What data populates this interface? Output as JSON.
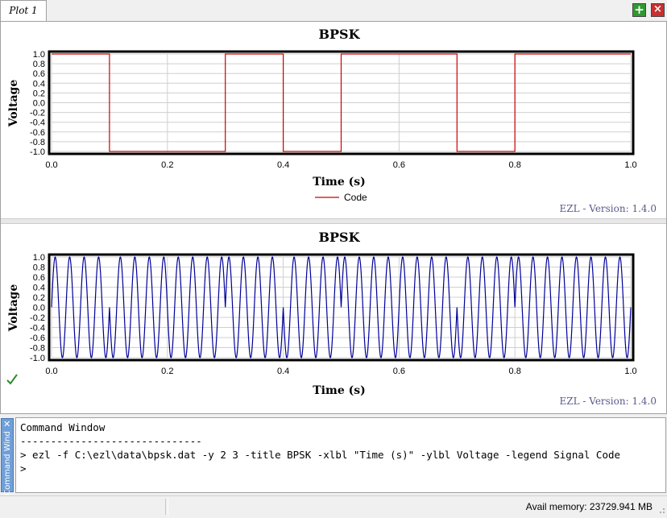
{
  "tab": {
    "label": "Plot 1"
  },
  "toolbar": {
    "add_icon": "plus-icon",
    "close_icon": "close-icon"
  },
  "plots": [
    {
      "title": "BPSK",
      "xlabel": "Time (s)",
      "ylabel": "Voltage",
      "legend": "Code",
      "version": "EZL - Version: 1.4.0"
    },
    {
      "title": "BPSK",
      "xlabel": "Time (s)",
      "ylabel": "Voltage",
      "version": "EZL - Version: 1.4.0"
    }
  ],
  "status_icon": "checkmark-icon",
  "command_window": {
    "side_label": "Command Wind",
    "lines": [
      "Command Window",
      "------------------------------",
      "> ezl -f C:\\ezl\\data\\bpsk.dat -y 2 3 -title BPSK -xlbl \"Time (s)\" -ylbl Voltage -legend Signal Code",
      ">"
    ]
  },
  "status_bar": {
    "memory": "Avail memory: 23729.941 MB"
  },
  "chart_data": [
    {
      "type": "line",
      "title": "BPSK",
      "xlabel": "Time (s)",
      "ylabel": "Voltage",
      "xlim": [
        0.0,
        1.0
      ],
      "ylim": [
        -1.0,
        1.0
      ],
      "xticks": [
        "0.0",
        "0.2",
        "0.4",
        "0.6",
        "0.8",
        "1.0"
      ],
      "yticks": [
        "1.0",
        "0.8",
        "0.6",
        "0.4",
        "0.2",
        "0.0",
        "-0.2",
        "-0.4",
        "-0.6",
        "-0.8",
        "-1.0"
      ],
      "grid": true,
      "legend_position": "bottom-center",
      "series": [
        {
          "name": "Code",
          "color": "#cc0000",
          "steps": [
            {
              "x0": 0.0,
              "x1": 0.1,
              "y": 1
            },
            {
              "x0": 0.1,
              "x1": 0.3,
              "y": -1
            },
            {
              "x0": 0.3,
              "x1": 0.4,
              "y": 1
            },
            {
              "x0": 0.4,
              "x1": 0.5,
              "y": -1
            },
            {
              "x0": 0.5,
              "x1": 0.7,
              "y": 1
            },
            {
              "x0": 0.7,
              "x1": 0.8,
              "y": -1
            },
            {
              "x0": 0.8,
              "x1": 1.0,
              "y": 1
            }
          ]
        }
      ]
    },
    {
      "type": "line",
      "title": "BPSK",
      "xlabel": "Time (s)",
      "ylabel": "Voltage",
      "xlim": [
        0.0,
        1.0
      ],
      "ylim": [
        -1.0,
        1.0
      ],
      "xticks": [
        "0.0",
        "0.2",
        "0.4",
        "0.6",
        "0.8",
        "1.0"
      ],
      "yticks": [
        "1.0",
        "0.8",
        "0.6",
        "0.4",
        "0.2",
        "0.0",
        "-0.2",
        "-0.4",
        "-0.6",
        "-0.8",
        "-1.0"
      ],
      "grid": true,
      "series": [
        {
          "color": "#000099",
          "carrier_cycles": 40,
          "phase_flips_at": [
            0.1,
            0.3,
            0.4,
            0.5,
            0.7,
            0.8
          ]
        }
      ]
    }
  ]
}
